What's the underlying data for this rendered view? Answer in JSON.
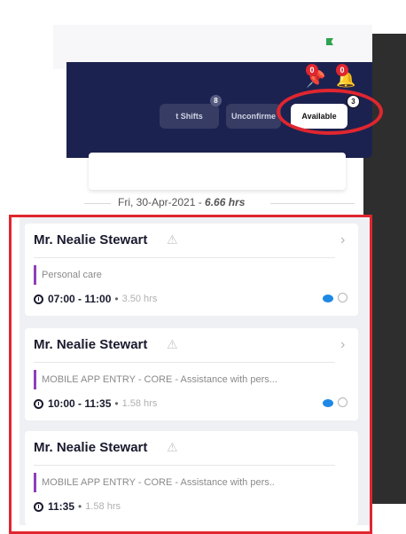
{
  "header": {
    "pin_badge": "0",
    "bell_badge": "0",
    "tabs": [
      {
        "label": "t Shifts",
        "count": "8"
      },
      {
        "label": "Unconfirme",
        "count": ""
      },
      {
        "label": "Available",
        "count": "3"
      }
    ]
  },
  "date_header": {
    "date": "Fri, 30-Apr-2021 - ",
    "hours": "6.66 hrs"
  },
  "shifts": [
    {
      "name": "Mr. Nealie Stewart",
      "description": "Personal care",
      "time": "07:00 - 11:00",
      "duration": "3.50 hrs"
    },
    {
      "name": "Mr. Nealie Stewart",
      "description": "MOBILE APP ENTRY - CORE - Assistance with pers...",
      "time": "10:00 - 11:35",
      "duration": "1.58 hrs"
    },
    {
      "name": "Mr. Nealie Stewart",
      "description": "MOBILE APP ENTRY - CORE - Assistance with pers..",
      "time": "11:35",
      "duration": "1.58 hrs"
    }
  ],
  "colors": {
    "header_bg": "#1c2250",
    "highlight_red": "#e0262f",
    "accent_purple": "#8e3fb8",
    "chat_blue": "#1e88e5"
  },
  "icons": [
    "pin-icon",
    "bell-icon",
    "warning-icon",
    "chevron-right-icon",
    "clock-icon",
    "chat-icon",
    "timer-icon"
  ]
}
